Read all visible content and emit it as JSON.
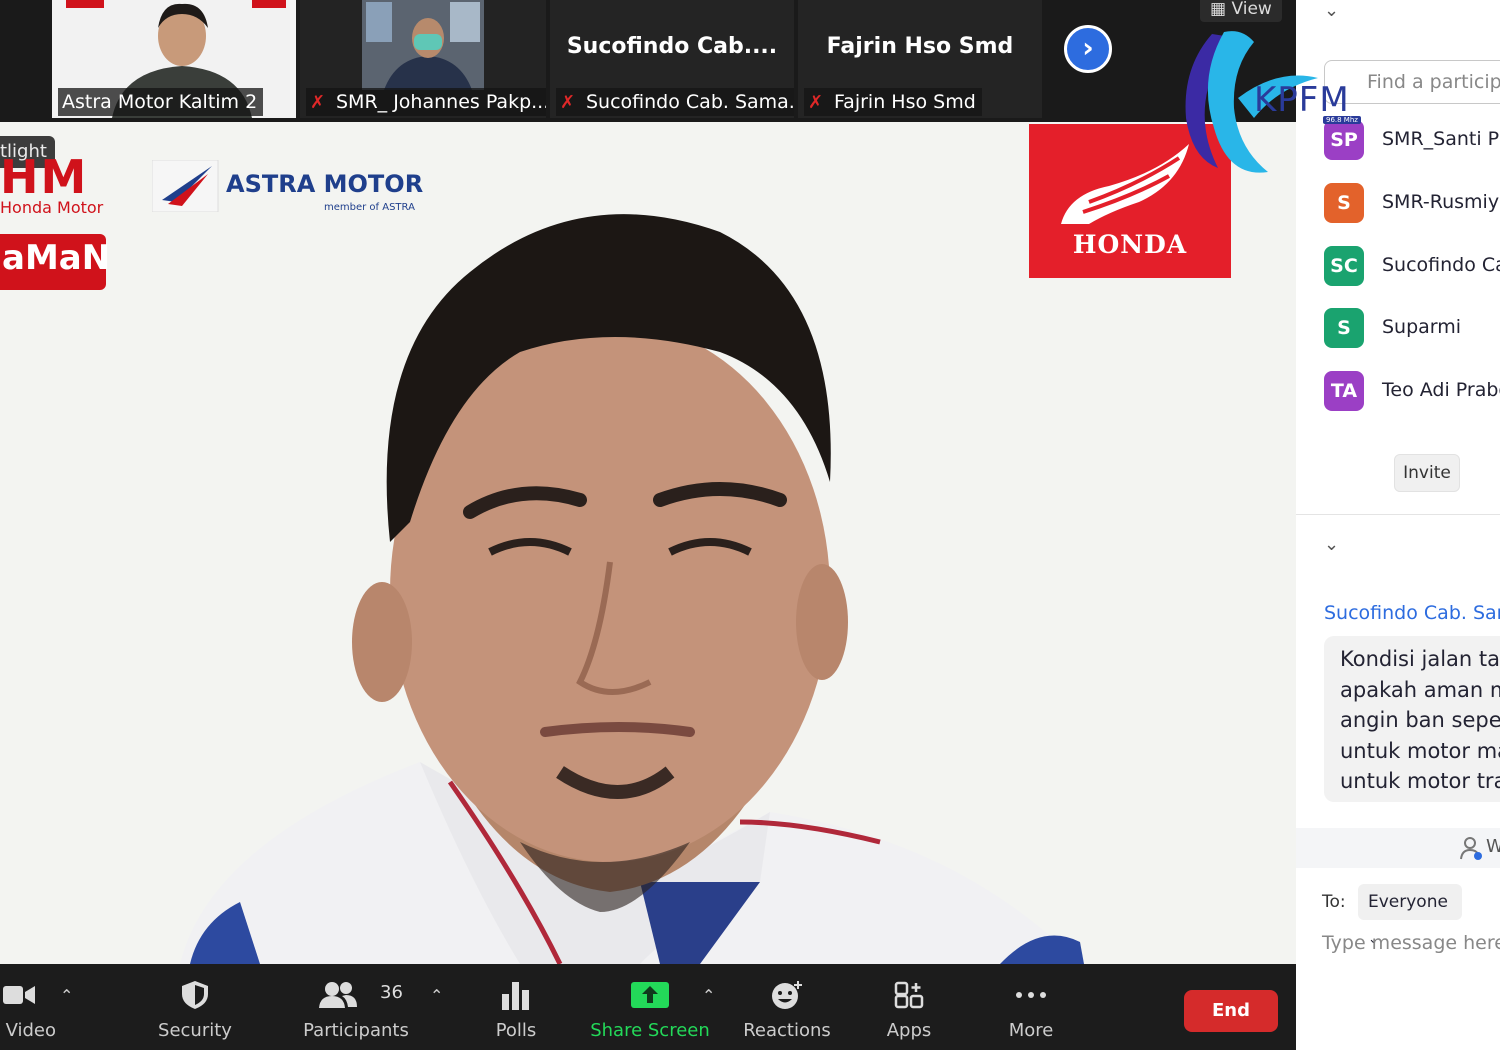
{
  "strip": {
    "tiles": [
      {
        "name": "Astra Motor Kaltim 2",
        "muted": false
      },
      {
        "name": "SMR_ Johannes Pakp...",
        "muted": true
      },
      {
        "name": "Sucofindo Cab. Sama...",
        "muted": true,
        "title": "Sucofindo  Cab...."
      },
      {
        "name": "Fajrin Hso Smd",
        "muted": true,
        "title": "Fajrin Hso Smd"
      }
    ],
    "next_label": "›",
    "view_label": "View"
  },
  "main_video": {
    "spotlight_label": "tlight",
    "ahm_logo": "HM",
    "ahm_sub": "Honda Motor",
    "astra_title": "ASTRA MOTOR",
    "astra_sub": "member of ASTRA",
    "aman_text": "aMaN",
    "honda_text": "HONDA"
  },
  "toolbar": {
    "video_label": "Video",
    "security_label": "Security",
    "participants_label": "Participants",
    "participants_count": "36",
    "polls_label": "Polls",
    "share_label": "Share Screen",
    "reactions_label": "Reactions",
    "apps_label": "Apps",
    "more_label": "More",
    "end_label": "End",
    "share_color": "#23d959"
  },
  "panel": {
    "find_placeholder": "Find a participant",
    "participants": [
      {
        "initials": "SP",
        "name": "SMR_Santi Pra",
        "color": "#9b3fc5"
      },
      {
        "initials": "S",
        "name": "SMR-Rusmiya",
        "color": "#e3622b"
      },
      {
        "initials": "SC",
        "name": "Sucofindo Ca",
        "color": "#1aa36f"
      },
      {
        "initials": "S",
        "name": "Suparmi",
        "color": "#1aa36f"
      },
      {
        "initials": "TA",
        "name": "Teo Adi Prabo",
        "color": "#9b3fc5"
      }
    ],
    "invite_label": "Invite",
    "chat_sender": "Sucofindo Cab. Sam",
    "chat_lines": [
      "Kondisi jalan tar",
      "apakah aman m",
      "angin ban seped",
      "untuk motor ma",
      "untuk motor trai"
    ],
    "who_text": "W",
    "to_label": "To:",
    "to_value": "Everyone",
    "message_placeholder": "Type message here..."
  },
  "watermark": {
    "brand": "KPFM",
    "freq": "96.8 Mhz"
  }
}
